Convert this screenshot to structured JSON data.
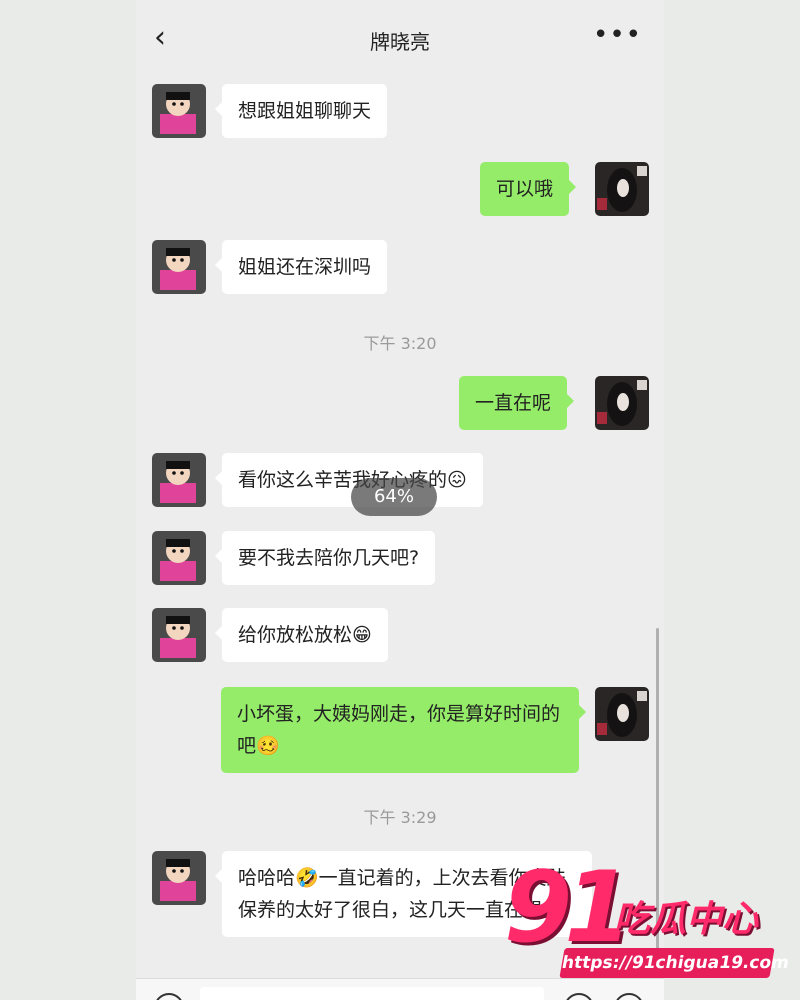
{
  "header": {
    "back_icon": "chevron-left-icon",
    "title": "牌晓亮",
    "more_icon": "more-dots-icon"
  },
  "messages": [
    {
      "side": "left",
      "text": "想跟姐姐聊聊天"
    },
    {
      "side": "right",
      "text": "可以哦"
    },
    {
      "side": "left",
      "text": "姐姐还在深圳吗"
    },
    {
      "side": "time",
      "text": "下午 3:20"
    },
    {
      "side": "right",
      "text": "一直在呢"
    },
    {
      "side": "left",
      "text": "看你这么辛苦我好心疼的😖"
    },
    {
      "side": "left",
      "text": "要不我去陪你几天吧?"
    },
    {
      "side": "left",
      "text": "给你放松放松😁"
    },
    {
      "side": "right",
      "text": "小坏蛋，大姨妈刚走，你是算好时间的吧🥴"
    },
    {
      "side": "time",
      "text": "下午 3:29"
    },
    {
      "side": "left",
      "text": "哈哈哈🤣一直记着的，上次去看你皮肤保养的太好了很白，这几天一直在想你"
    }
  ],
  "overlay": {
    "progress_label": "64%"
  },
  "watermark": {
    "number": "91",
    "name": "吃瓜中心",
    "url": "https://91chigua19.com"
  },
  "colors": {
    "sent_bubble": "#95ec69",
    "received_bubble": "#ffffff",
    "background": "#ededed",
    "watermark": "#ff2a6a"
  }
}
